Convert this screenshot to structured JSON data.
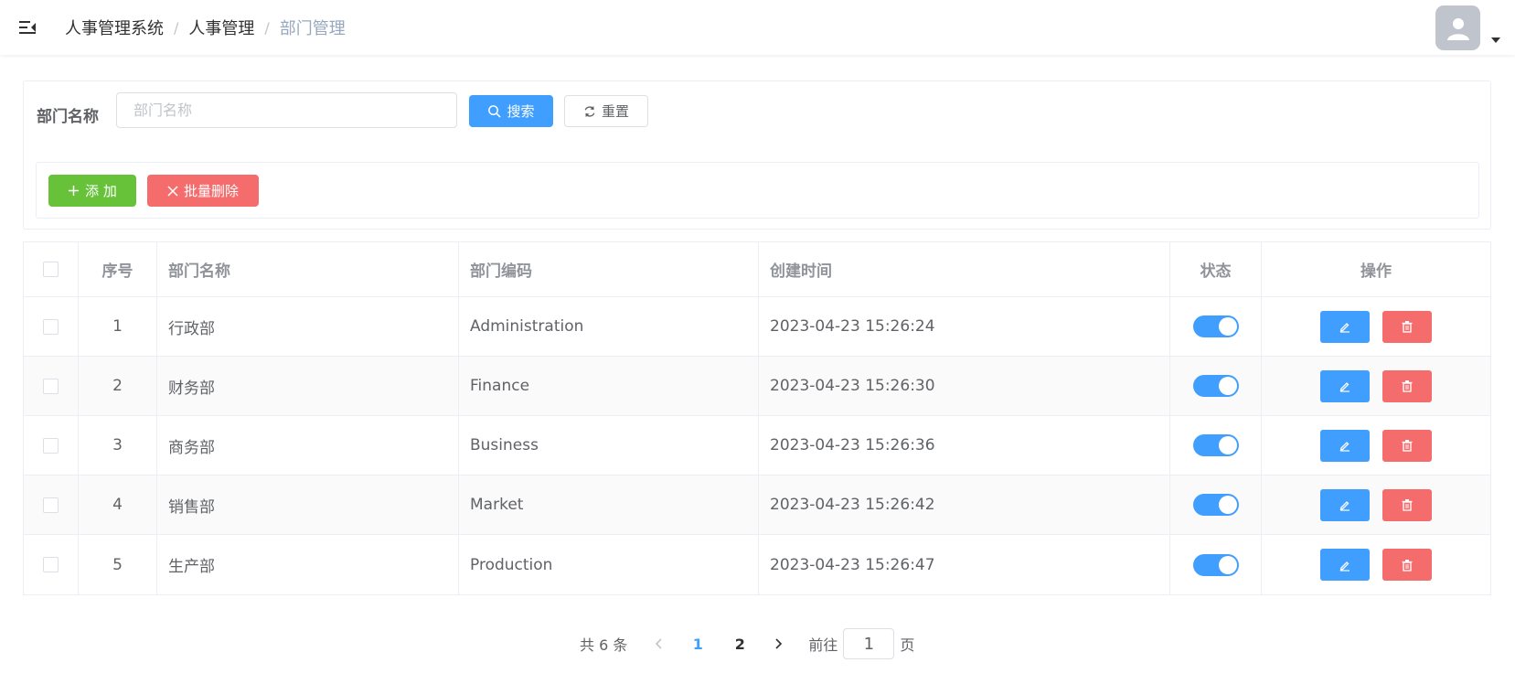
{
  "header": {
    "breadcrumb": [
      "人事管理系统",
      "人事管理",
      "部门管理"
    ],
    "separator": "/",
    "icons": {
      "menu": "hamburger-icon",
      "avatar": "user-avatar-icon",
      "caret": "caret-down-icon"
    }
  },
  "search": {
    "label": "部门名称",
    "input_value": "",
    "input_placeholder": "部门名称",
    "search_button": "搜索",
    "reset_button": "重置"
  },
  "toolbar": {
    "add_button": "添 加",
    "batch_delete_button": "批量删除"
  },
  "table": {
    "columns": [
      "序号",
      "部门名称",
      "部门编码",
      "创建时间",
      "状态",
      "操作"
    ],
    "rows": [
      {
        "index": "1",
        "name": "行政部",
        "code": "Administration",
        "created": "2023-04-23 15:26:24",
        "enabled": true
      },
      {
        "index": "2",
        "name": "财务部",
        "code": "Finance",
        "created": "2023-04-23 15:26:30",
        "enabled": true
      },
      {
        "index": "3",
        "name": "商务部",
        "code": "Business",
        "created": "2023-04-23 15:26:36",
        "enabled": true
      },
      {
        "index": "4",
        "name": "销售部",
        "code": "Market",
        "created": "2023-04-23 15:26:42",
        "enabled": true
      },
      {
        "index": "5",
        "name": "生产部",
        "code": "Production",
        "created": "2023-04-23 15:26:47",
        "enabled": true
      }
    ]
  },
  "pagination": {
    "total_text": "共 6 条",
    "pages": [
      "1",
      "2"
    ],
    "current_page": "1",
    "goto_prefix": "前往",
    "goto_value": "1",
    "goto_suffix": "页"
  },
  "colors": {
    "primary": "#409eff",
    "success": "#67c23a",
    "danger": "#f56c6c"
  }
}
